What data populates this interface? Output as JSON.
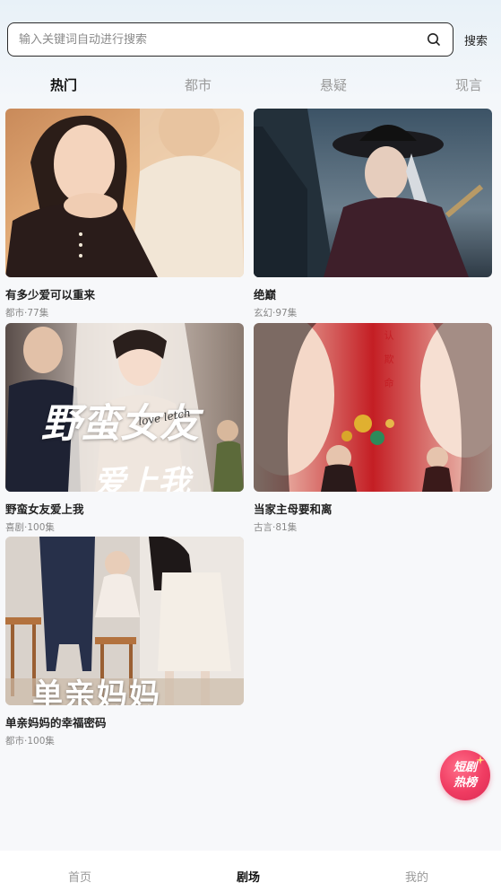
{
  "search": {
    "placeholder": "输入关键词自动进行搜索",
    "button_label": "搜索"
  },
  "tabs": [
    {
      "label": "热门",
      "active": true
    },
    {
      "label": "都市",
      "active": false
    },
    {
      "label": "悬疑",
      "active": false
    },
    {
      "label": "现言",
      "active": false
    }
  ],
  "dramas": [
    {
      "title": "有多少爱可以重来",
      "meta": "都市·77集"
    },
    {
      "title": "绝巅",
      "meta": "玄幻·97集"
    },
    {
      "title": "野蛮女友爱上我",
      "meta": "喜剧·100集",
      "cover_text": "野蛮女友",
      "cover_text2": "爱上我",
      "cover_script": "love letch"
    },
    {
      "title": "当家主母要和离",
      "meta": "古言·81集",
      "cover_text": "认 欺 命"
    },
    {
      "title": "单亲妈妈的幸福密码",
      "meta": "都市·100集",
      "cover_text": "单亲妈妈"
    }
  ],
  "hot_badge": {
    "line1": "短剧",
    "line2": "热榜"
  },
  "bottom_nav": [
    {
      "label": "首页",
      "active": false
    },
    {
      "label": "剧场",
      "active": true
    },
    {
      "label": "我的",
      "active": false
    }
  ],
  "colors": {
    "accent_badge": "#f03c62",
    "active_text": "#111111",
    "inactive_text": "#999999"
  }
}
